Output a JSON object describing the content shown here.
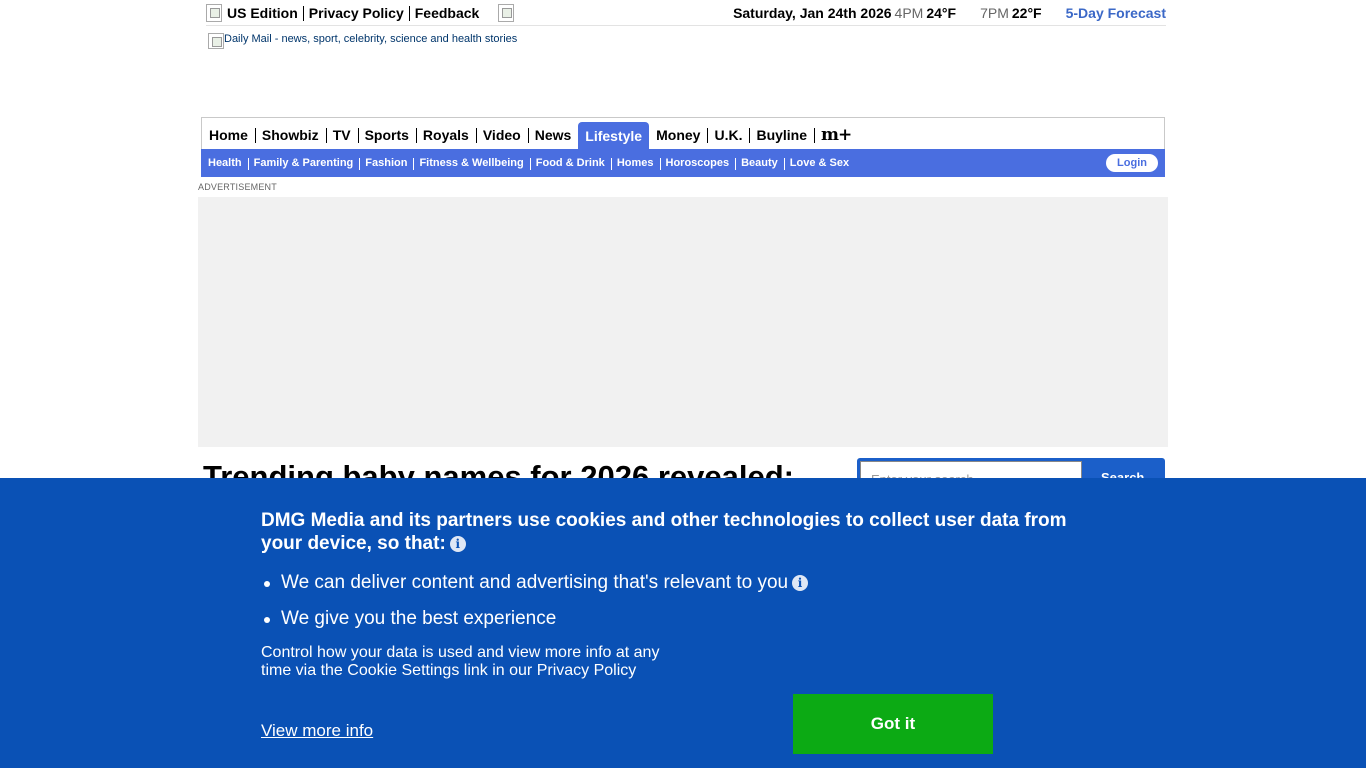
{
  "topbar": {
    "edition": "US Edition",
    "privacy": "Privacy Policy",
    "feedback": "Feedback",
    "date": "Saturday, Jan 24th 2026",
    "time1": "4PM",
    "temp1": "24°F",
    "time2": "7PM",
    "temp2": "22°F",
    "forecast": "5-Day Forecast"
  },
  "logo": {
    "alt": "Daily Mail - news, sport, celebrity, science and health stories"
  },
  "nav": {
    "items": [
      "Home",
      "Showbiz",
      "TV",
      "Sports",
      "Royals",
      "Video",
      "News",
      "Lifestyle",
      "Money",
      "U.K.",
      "Buyline"
    ],
    "active": "Lifestyle",
    "plus_label": "m+"
  },
  "subnav": {
    "items": [
      "Health",
      "Family & Parenting",
      "Fashion",
      "Fitness & Wellbeing",
      "Food & Drink",
      "Homes",
      "Horoscopes",
      "Beauty",
      "Love & Sex"
    ],
    "login": "Login"
  },
  "ad": {
    "label": "ADVERTISEMENT"
  },
  "article": {
    "headline": "Trending baby names for 2026 revealed:"
  },
  "search": {
    "placeholder": "Enter your search",
    "button": "Search"
  },
  "consent": {
    "title": "DMG Media and its partners use cookies and other technologies to collect user data from your device, so that:",
    "bullet1": "We can deliver content and advertising that's relevant to you",
    "bullet2": "We give you the best experience",
    "control": "Control how your data is used and view more info at any time via the Cookie Settings link in our Privacy Policy",
    "more": "View more info",
    "accept": "Got it"
  },
  "colors": {
    "nav_blue": "#4a6ee0",
    "consent_blue": "#0a51b5",
    "accept_green": "#0caa14",
    "forecast_link": "#3b68c7"
  }
}
